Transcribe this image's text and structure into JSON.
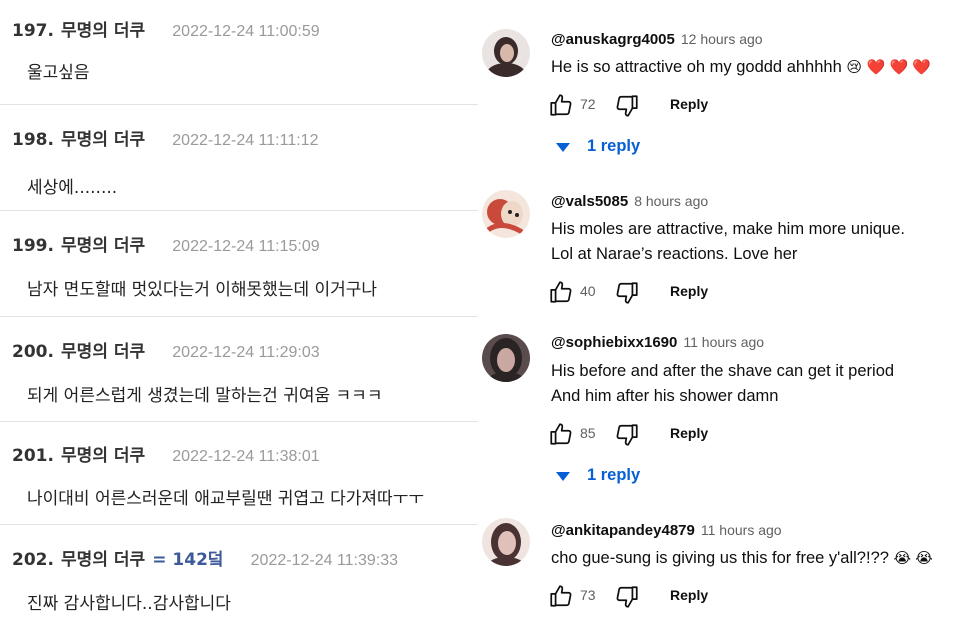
{
  "korean_comments": [
    {
      "number": "197.",
      "nickname": "무명의 더쿠",
      "badge": "",
      "timestamp": "2022-12-24 11:00:59",
      "text": "울고싶음"
    },
    {
      "number": "198.",
      "nickname": "무명의 더쿠",
      "badge": "",
      "timestamp": "2022-12-24 11:11:12",
      "text": "세상에........"
    },
    {
      "number": "199.",
      "nickname": "무명의 더쿠",
      "badge": "",
      "timestamp": "2022-12-24 11:15:09",
      "text": "남자 면도할때 멋있다는거 이해못했는데 이거구나"
    },
    {
      "number": "200.",
      "nickname": "무명의 더쿠",
      "badge": "",
      "timestamp": "2022-12-24 11:29:03",
      "text": "되게 어른스럽게 생겼는데 말하는건 귀여움 ㅋㅋㅋ"
    },
    {
      "number": "201.",
      "nickname": "무명의 더쿠",
      "badge": "",
      "timestamp": "2022-12-24 11:38:01",
      "text": "나이대비 어른스러운데 애교부릴땐 귀엽고 다가져따ㅜㅜ"
    },
    {
      "number": "202.",
      "nickname": "무명의 더쿠",
      "badge": "= 142덬",
      "timestamp": "2022-12-24 11:39:33",
      "text": "진짜 감사합니다..감사합니다"
    }
  ],
  "youtube_comments": [
    {
      "handle": "@anuskagrg4005",
      "time_ago": "12 hours ago",
      "lines": [
        "He is so attractive oh my goddd ahhhhh"
      ],
      "emojis": "😢",
      "hearts": "❤️ ❤️ ❤️",
      "likes": "72",
      "reply_label": "Reply",
      "replies_label": "1 reply",
      "avatar_colors": [
        "#3a2a2a",
        "#d8b8a8"
      ]
    },
    {
      "handle": "@vals5085",
      "time_ago": "8 hours ago",
      "lines": [
        "His moles are attractive, make him more unique.",
        "Lol at Narae’s reactions. Love her"
      ],
      "emojis": "",
      "hearts": "",
      "likes": "40",
      "reply_label": "Reply",
      "replies_label": "",
      "avatar_colors": [
        "#c94a3a",
        "#f0d8c8"
      ]
    },
    {
      "handle": "@sophiebixx1690",
      "time_ago": "11 hours ago",
      "lines": [
        "His before and after the shave can get it period",
        "And him after his shower damn"
      ],
      "emojis": "",
      "hearts": "",
      "likes": "85",
      "reply_label": "Reply",
      "replies_label": "1 reply",
      "avatar_colors": [
        "#2a2424",
        "#c8a8a0"
      ]
    },
    {
      "handle": "@ankitapandey4879",
      "time_ago": "11 hours ago",
      "lines": [
        "cho gue-sung is giving us this for free y'all?!??"
      ],
      "emojis": "😭 😭",
      "hearts": "",
      "likes": "73",
      "reply_label": "Reply",
      "replies_label": "",
      "avatar_colors": [
        "#4a3232",
        "#e0c0b8"
      ]
    }
  ],
  "colors": {
    "link_blue": "#065fd4",
    "badge_blue": "#3e5a99",
    "timestamp_gray": "#9a9a9a",
    "divider": "#e3e3e3"
  }
}
